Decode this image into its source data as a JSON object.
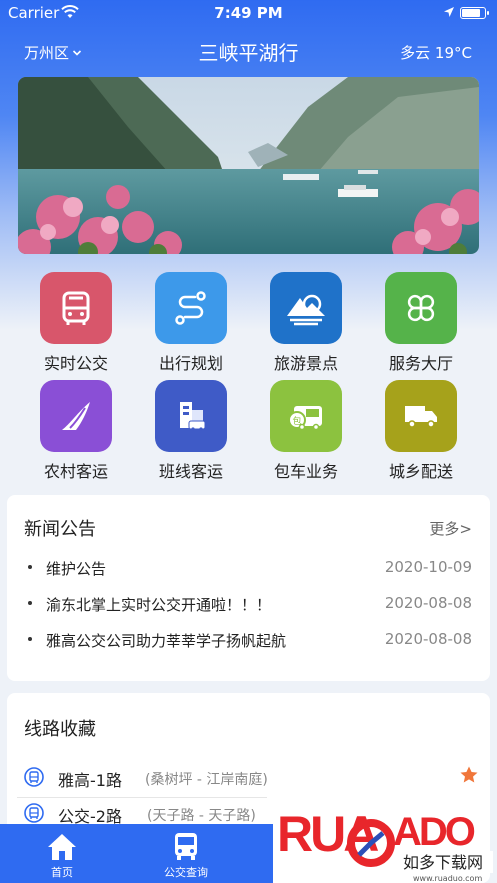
{
  "status_bar": {
    "carrier": "Carrier",
    "time": "7:49 PM",
    "battery_level": 0.85
  },
  "header": {
    "district": "万州区",
    "title": "三峡平湖行",
    "weather": "多云 19°C"
  },
  "banner": {
    "description": ""
  },
  "services": [
    {
      "label": "实时公交",
      "icon": "bus-icon",
      "color": "#d8566b"
    },
    {
      "label": "出行规划",
      "icon": "route-icon",
      "color": "#3d99ea"
    },
    {
      "label": "旅游景点",
      "icon": "mountain-icon",
      "color": "#1f72c9"
    },
    {
      "label": "服务大厅",
      "icon": "clover-icon",
      "color": "#55b34a"
    },
    {
      "label": "农村客运",
      "icon": "road-icon",
      "color": "#8a4fd6"
    },
    {
      "label": "班线客运",
      "icon": "station-icon",
      "color": "#3f5bc7"
    },
    {
      "label": "包车业务",
      "icon": "charter-bus-icon",
      "color": "#8cc23f"
    },
    {
      "label": "城乡配送",
      "icon": "truck-icon",
      "color": "#a6a21b"
    }
  ],
  "news": {
    "title": "新闻公告",
    "more": "更多>",
    "items": [
      {
        "text": "维护公告",
        "date": "2020-10-09"
      },
      {
        "text": "渝东北掌上实时公交开通啦！！！",
        "date": "2020-08-08"
      },
      {
        "text": "雅高公交公司助力莘莘学子扬帆起航",
        "date": "2020-08-08"
      }
    ]
  },
  "favorites": {
    "title": "线路收藏",
    "items": [
      {
        "name": "雅高-1路",
        "range": "(桑树坪 - 江岸南庭)",
        "starred": true
      },
      {
        "name": "公交-2路",
        "range": "(天子路 - 天子路)",
        "starred": false
      }
    ]
  },
  "tabbar": {
    "tabs": [
      {
        "label": "首页",
        "icon": "home-icon"
      },
      {
        "label": "公交查询",
        "icon": "bus-icon"
      }
    ]
  },
  "watermark": {
    "logo_text": "RUADADO",
    "sub_text": "如多下载网",
    "url": "www.ruaduo.com"
  },
  "colors": {
    "primary": "#2f6bf1",
    "star": "#f0763a"
  }
}
